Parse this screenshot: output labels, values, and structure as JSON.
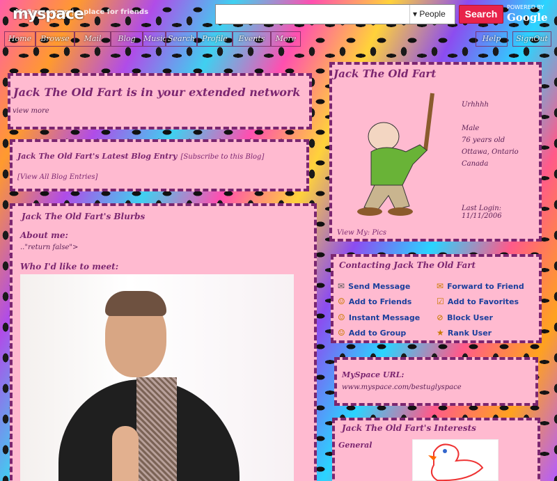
{
  "header": {
    "logo": "myspace",
    "logo_sub": "MySpace.com | a place for friends",
    "search_placeholder": "",
    "search_scope": "People",
    "search_button": "Search",
    "powered_by": "POWERED BY",
    "google": "Google"
  },
  "nav": [
    "Home",
    "Browse",
    "Mail",
    "Blog",
    "Music",
    "Search",
    "Profile",
    "Events",
    "More",
    "Help",
    "SignOut"
  ],
  "network_banner": {
    "title": "Jack The Old Fart is in your extended network",
    "view_more": "view more"
  },
  "blog": {
    "title": "Jack The Old Fart's Latest Blog Entry",
    "subscribe": "[Subscribe to this Blog]",
    "view_all": "[View All Blog Entries]"
  },
  "blurbs": {
    "title": "Jack The Old Fart's Blurbs",
    "about_heading": "About me:",
    "about_text": "..\"return false\">",
    "meet_heading": "Who I'd like to meet:"
  },
  "profile": {
    "name": "Jack The Old Fart",
    "headline": "Urhhhh",
    "gender": "Male",
    "age": "76 years old",
    "city": "Ottawa, Ontario",
    "country": "Canada",
    "last_login": "Last Login: 11/11/2006",
    "view_my_label": "View My:",
    "pics_link": "Pics"
  },
  "contact": {
    "title": "Contacting Jack The Old Fart",
    "actions": [
      "Send Message",
      "Forward to Friend",
      "Add to Friends",
      "Add to Favorites",
      "Instant Message",
      "Block User",
      "Add to Group",
      "Rank User"
    ]
  },
  "url_box": {
    "label": "MySpace URL:",
    "url": "www.myspace.com/bestuglyspace"
  },
  "interests": {
    "title": "Jack The Old Fart's Interests",
    "general": "General"
  },
  "colors": {
    "panel_bg": "#ffbad0",
    "border": "#7b2670",
    "title": "#7b2670",
    "link": "#1b3f9c",
    "search_button": "#e8234a"
  }
}
